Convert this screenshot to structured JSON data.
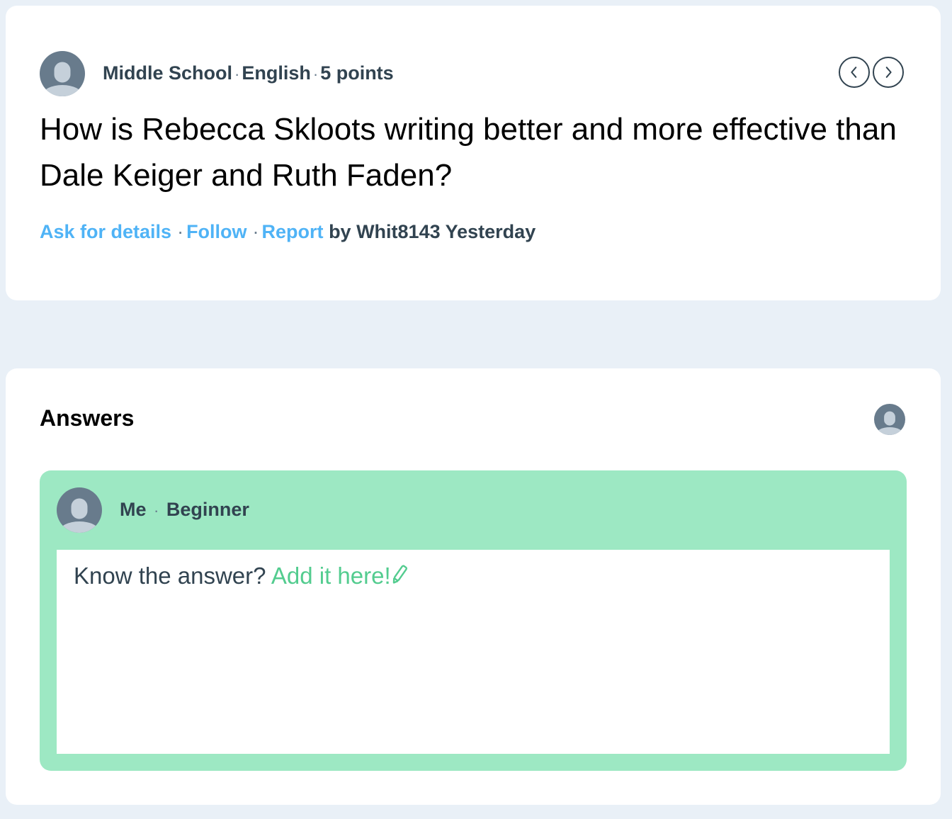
{
  "question": {
    "meta": {
      "level": "Middle School",
      "subject": "English",
      "points": "5 points",
      "separator": "·"
    },
    "text": "How is Rebecca Skloots writing better and more effective than Dale Keiger and Ruth Faden?",
    "actions": {
      "ask_for_details": "Ask for details",
      "follow": "Follow",
      "report": "Report",
      "separator": "·"
    },
    "author_line": "by Whit8143 Yesterday",
    "nav": {
      "prev_icon": "chevron-left-icon",
      "next_icon": "chevron-right-icon"
    }
  },
  "answers": {
    "title": "Answers",
    "user": {
      "name": "Me",
      "separator": "·",
      "rank": "Beginner"
    },
    "prompt": {
      "question": "Know the answer?",
      "cta": "Add it here!",
      "icon": "pencil-icon"
    }
  },
  "colors": {
    "background": "#e9f0f7",
    "link_blue": "#4fb3f6",
    "answer_green": "#9de8c3",
    "cta_green": "#53cc8f",
    "text_dark": "#314350",
    "avatar_gray": "#687b8c"
  }
}
